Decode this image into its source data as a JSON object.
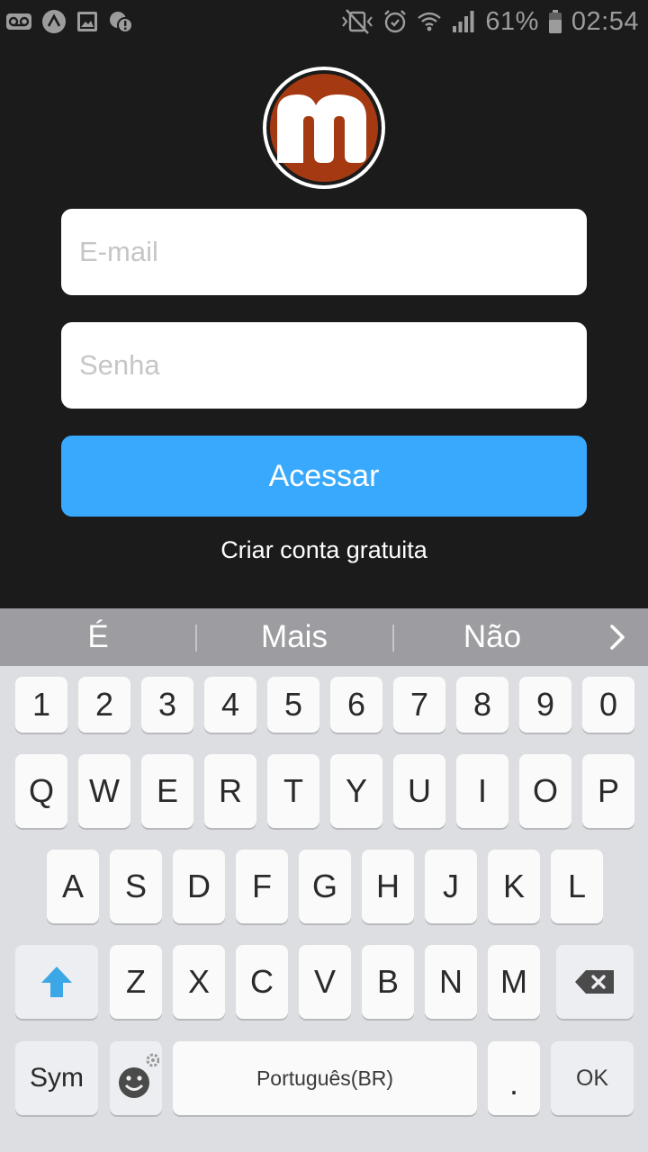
{
  "status_bar": {
    "time": "02:54",
    "battery_percent": "61%",
    "left_icons": [
      "voicemail-icon",
      "app-notification-icon",
      "image-icon",
      "data-alert-icon"
    ],
    "right_icons": [
      "mute-icon",
      "alarm-icon",
      "wifi-icon",
      "signal-icon",
      "battery-icon"
    ]
  },
  "app": {
    "logo_letter": "m",
    "brand_color": "#a53a12",
    "email_placeholder": "E-mail",
    "password_placeholder": "Senha",
    "login_button": "Acessar",
    "create_account_link": "Criar conta gratuita",
    "accent_color": "#39a9fd"
  },
  "keyboard": {
    "suggestions": [
      "É",
      "Mais",
      "Não"
    ],
    "row_numbers": [
      "1",
      "2",
      "3",
      "4",
      "5",
      "6",
      "7",
      "8",
      "9",
      "0"
    ],
    "row_1": [
      "Q",
      "W",
      "E",
      "R",
      "T",
      "Y",
      "U",
      "I",
      "O",
      "P"
    ],
    "row_2": [
      "A",
      "S",
      "D",
      "F",
      "G",
      "H",
      "J",
      "K",
      "L"
    ],
    "row_3": [
      "Z",
      "X",
      "C",
      "V",
      "B",
      "N",
      "M"
    ],
    "sym_label": "Sym",
    "space_label": "Português(BR)",
    "period_label": ".",
    "ok_label": "OK"
  }
}
